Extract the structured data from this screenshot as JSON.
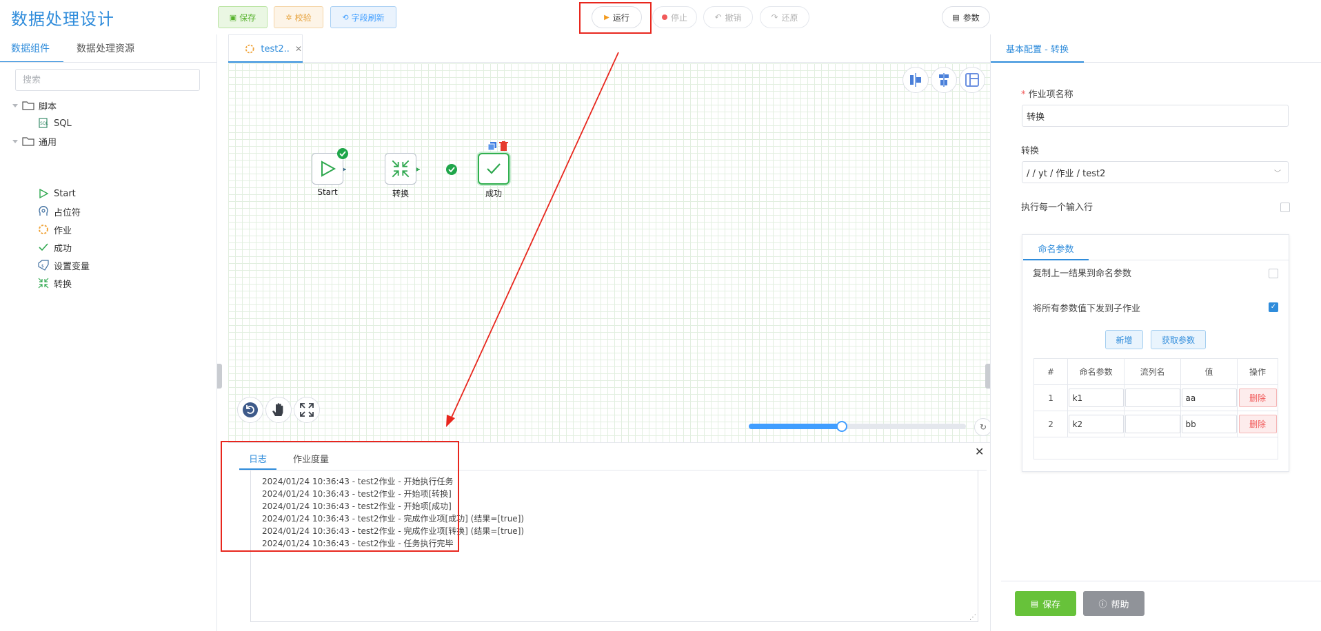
{
  "app": {
    "title": "数据处理设计"
  },
  "toolbar": {
    "save": "保存",
    "validate": "校验",
    "refresh_fields": "字段刷新",
    "run": "运行",
    "stop": "停止",
    "undo": "撤销",
    "redo": "还原",
    "params": "参数",
    "colors": {
      "save": "#67c23a",
      "validate": "#e6a23c",
      "refresh": "#409eff",
      "highlight": "#e8261d"
    }
  },
  "left_panel": {
    "tabs": [
      "数据组件",
      "数据处理资源"
    ],
    "active_tab": "数据组件",
    "search_placeholder": "搜索",
    "tree": [
      {
        "label": "脚本",
        "icon": "folder-icon",
        "children": [
          {
            "label": "SQL",
            "icon": "sql-icon"
          }
        ]
      },
      {
        "label": "通用",
        "icon": "folder-icon",
        "children": [
          {
            "label": "Start",
            "icon": "play-icon"
          },
          {
            "label": "占位符",
            "icon": "placeholder-head-icon"
          },
          {
            "label": "作业",
            "icon": "job-spinner-icon"
          },
          {
            "label": "成功",
            "icon": "check-icon"
          },
          {
            "label": "设置变量",
            "icon": "set-variable-icon"
          },
          {
            "label": "转换",
            "icon": "transform-icon"
          }
        ]
      }
    ]
  },
  "editor": {
    "tab_label": "test2..",
    "nodes": [
      {
        "label": "Start",
        "icon": "play-icon"
      },
      {
        "label": "转换",
        "icon": "transform-icon"
      },
      {
        "label": "成功",
        "icon": "check-icon"
      }
    ]
  },
  "log_panel": {
    "tabs": [
      "日志",
      "作业度量"
    ],
    "active_tab": "日志",
    "lines": [
      "2024/01/24 10:36:43 - test2作业 - 开始执行任务",
      "2024/01/24 10:36:43 - test2作业 - 开始项[转换]",
      "2024/01/24 10:36:43 - test2作业 - 开始项[成功]",
      "2024/01/24 10:36:43 - test2作业 - 完成作业项[成功] (结果=[true])",
      "2024/01/24 10:36:43 - test2作业 - 完成作业项[转换] (结果=[true])",
      "2024/01/24 10:36:43 - test2作业 - 任务执行完毕"
    ]
  },
  "right_panel": {
    "tab": "基本配置 - 转换",
    "job_name_label": "作业项名称",
    "required_mark": "*",
    "job_name_value": "转换",
    "transform_label": "转换",
    "transform_value": "/ / yt / 作业 / test2",
    "exec_each_row_label": "执行每一个输入行",
    "exec_each_row_checked": false,
    "named_params_tab": "命名参数",
    "copy_prev_result_label": "复制上一结果到命名参数",
    "copy_prev_result_checked": false,
    "pass_all_params_label": "将所有参数值下发到子作业",
    "pass_all_params_checked": true,
    "add_button": "新增",
    "get_params_button": "获取参数",
    "table_headers": [
      "#",
      "命名参数",
      "流列名",
      "值",
      "操作"
    ],
    "rows": [
      {
        "index": "1",
        "param": "k1",
        "stream_col": "",
        "value": "aa",
        "action": "删除"
      },
      {
        "index": "2",
        "param": "k2",
        "stream_col": "",
        "value": "bb",
        "action": "删除"
      }
    ],
    "save_button": "保存",
    "help_button": "帮助",
    "colors": {
      "save": "#67c23a",
      "help": "#909399",
      "accent": "#2f8cdb"
    }
  },
  "zoom": {
    "level_fraction": 0.43
  }
}
